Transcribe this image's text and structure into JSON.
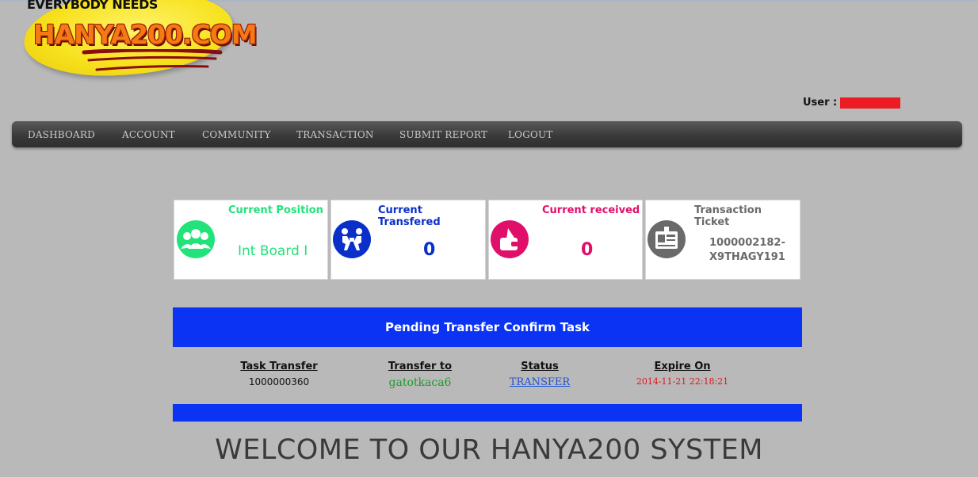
{
  "logo": {
    "tagline": "EVERYBODY NEEDS",
    "brand": "HANYA200.COM"
  },
  "user": {
    "label": "User :"
  },
  "nav": {
    "items": [
      {
        "label": "DASHBOARD"
      },
      {
        "label": "ACCOUNT"
      },
      {
        "label": "COMMUNITY"
      },
      {
        "label": "TRANSACTION"
      },
      {
        "label": "SUBMIT REPORT"
      },
      {
        "label": "LOGOUT"
      }
    ]
  },
  "cards": {
    "position": {
      "title": "Current Position",
      "value": "Int Board I",
      "color": "#22e27a",
      "icon": "group-icon"
    },
    "transfered": {
      "title": "Current Transfered",
      "value": "0",
      "color": "#0b2fc9",
      "icon": "handover-icon"
    },
    "received": {
      "title": "Current received",
      "value": "0",
      "color": "#e0106a",
      "icon": "wallet-icon"
    },
    "ticket": {
      "title": "Transaction Ticket",
      "value_line1": "1000002182-",
      "value_line2": "X9THAGY191",
      "color": "#6a6a6a",
      "icon": "vip-ticket-icon"
    }
  },
  "pending": {
    "title": "Pending Transfer Confirm Task",
    "columns": [
      {
        "header": "Task Transfer",
        "value": "1000000360"
      },
      {
        "header": "Transfer to",
        "value": "gatotkaca6"
      },
      {
        "header": "Status",
        "value": "TRANSFER"
      },
      {
        "header": "Expire On",
        "value": "2014-11-21 22:18:21"
      }
    ],
    "colors": {
      "panel": "#0b33f3",
      "recipient": "#1f9a2c",
      "link": "#1a52d8",
      "expire": "#e0141a"
    }
  },
  "welcome": "WELCOME TO OUR HANYA200 SYSTEM"
}
